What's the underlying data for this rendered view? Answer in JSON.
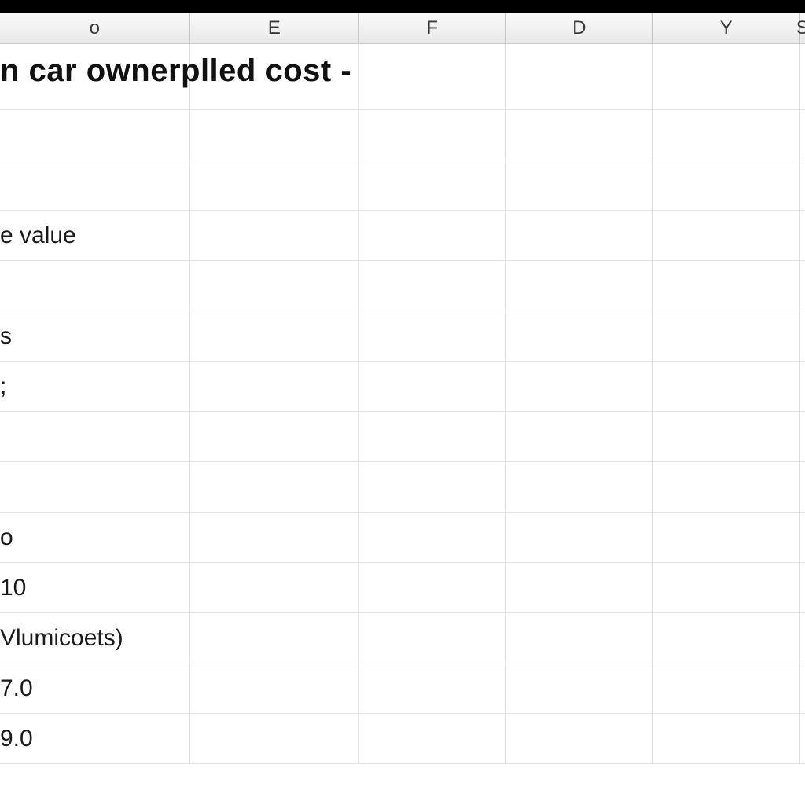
{
  "columns": [
    "o",
    "E",
    "F",
    "D",
    "Y",
    "S"
  ],
  "rows": {
    "r0": "n car ownerplled cost -",
    "r1": "",
    "r2": "",
    "r3": "e value",
    "r4": "",
    "r5": "s",
    "r6": ";",
    "r7": "",
    "r8": "",
    "r9": "o",
    "r10": "10",
    "r11": "Vlumicoets)",
    "r12": "7.0",
    "r13": "9.0"
  }
}
